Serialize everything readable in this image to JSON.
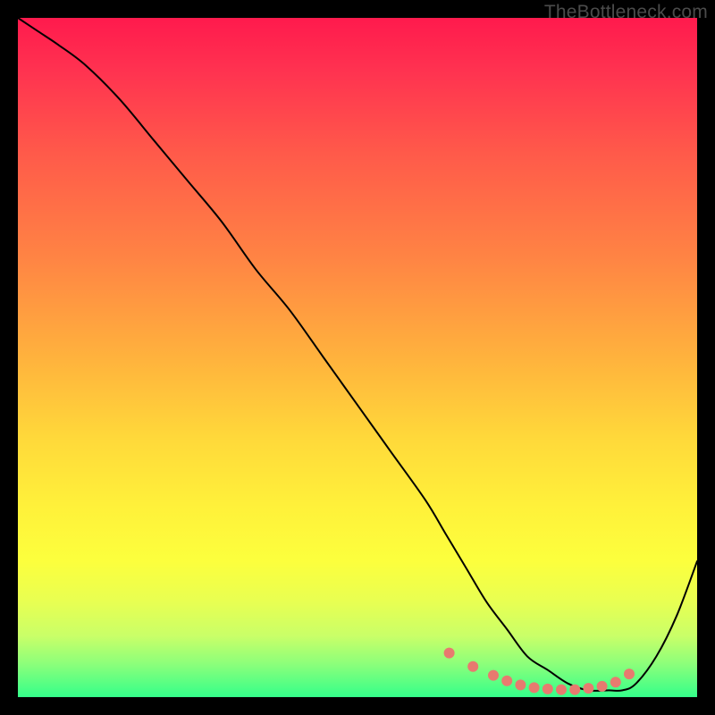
{
  "watermark": "TheBottleneck.com",
  "chart_data": {
    "type": "line",
    "title": "",
    "xlabel": "",
    "ylabel": "",
    "xlim": [
      0,
      100
    ],
    "ylim": [
      0,
      100
    ],
    "grid": false,
    "legend": false,
    "series": [
      {
        "name": "curve",
        "color": "#000000",
        "stroke_width": 2,
        "x": [
          0,
          3,
          6,
          10,
          15,
          20,
          25,
          30,
          35,
          40,
          45,
          50,
          55,
          60,
          63,
          66,
          69,
          72,
          75,
          78,
          81,
          84,
          87,
          89,
          91,
          94,
          97,
          100
        ],
        "y": [
          100,
          98,
          96,
          93,
          88,
          82,
          76,
          70,
          63,
          57,
          50,
          43,
          36,
          29,
          24,
          19,
          14,
          10,
          6,
          4,
          2,
          1,
          1,
          1,
          2,
          6,
          12,
          20
        ]
      }
    ],
    "markers": {
      "name": "dots",
      "color": "#e87a6f",
      "radius": 6,
      "x": [
        63.5,
        67,
        70,
        72,
        74,
        76,
        78,
        80,
        82,
        84,
        86,
        88,
        90
      ],
      "y": [
        6.5,
        4.5,
        3.2,
        2.4,
        1.8,
        1.4,
        1.2,
        1.1,
        1.1,
        1.3,
        1.6,
        2.2,
        3.4
      ]
    },
    "gradient_stops": [
      {
        "pct": 0,
        "color": "#ff1a4d"
      },
      {
        "pct": 8,
        "color": "#ff3350"
      },
      {
        "pct": 20,
        "color": "#ff5a4a"
      },
      {
        "pct": 35,
        "color": "#ff8344"
      },
      {
        "pct": 50,
        "color": "#ffb23d"
      },
      {
        "pct": 62,
        "color": "#ffd93a"
      },
      {
        "pct": 72,
        "color": "#fff13a"
      },
      {
        "pct": 80,
        "color": "#fcff3d"
      },
      {
        "pct": 86,
        "color": "#e8ff52"
      },
      {
        "pct": 91,
        "color": "#c9ff68"
      },
      {
        "pct": 95,
        "color": "#8eff7a"
      },
      {
        "pct": 100,
        "color": "#34ff8a"
      }
    ]
  }
}
